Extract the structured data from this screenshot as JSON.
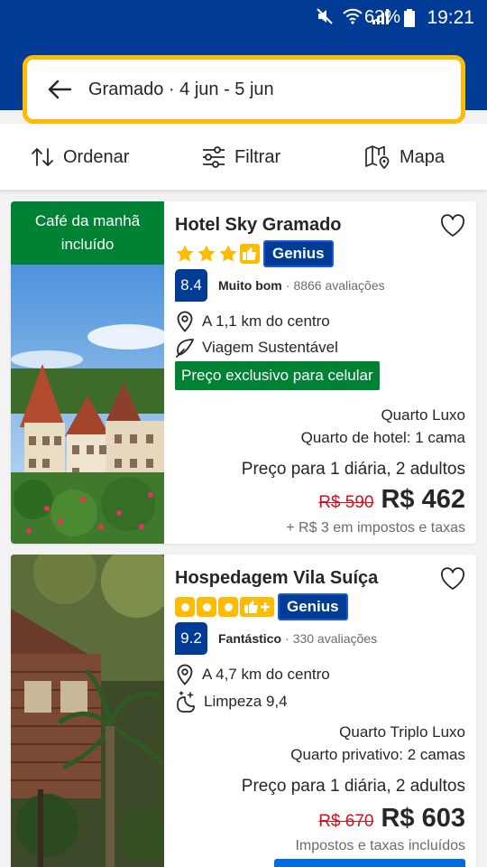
{
  "status_bar": {
    "battery_percent": "63%",
    "time": "19:21",
    "icons": [
      "mute-icon",
      "wifi-icon",
      "signal-icon",
      "battery-icon"
    ]
  },
  "search": {
    "query": "Gramado · 4 jun - 5 jun"
  },
  "toolbar": {
    "sort_label": "Ordenar",
    "filter_label": "Filtrar",
    "map_label": "Mapa"
  },
  "colors": {
    "brand_blue": "#003b95",
    "accent_yellow": "#febb02",
    "green": "#008234",
    "strike_red": "#d4111e"
  },
  "hotels": [
    {
      "breakfast_badge": "Café da manhã incluído",
      "name": "Hotel Sky Gramado",
      "star_count": 3,
      "genius_label": "Genius",
      "score": "8.4",
      "score_label": "Muito bom",
      "reviews": "8866 avaliações",
      "distance": "A 1,1 km do centro",
      "sustainable": "Viagem Sustentável",
      "mobile_deal": "Preço exclusivo para celular",
      "room_type": "Quarto Luxo",
      "room_detail": "Quarto de hotel: 1 cama",
      "price_desc": "Preço para 1 diária, 2 adultos",
      "old_price": "R$ 590",
      "price": "R$ 462",
      "taxes": "+ R$ 3 em impostos e taxas"
    },
    {
      "name": "Hospedagem Vila Suíça",
      "rating_count": 3,
      "genius_label": "Genius",
      "score": "9.2",
      "score_label": "Fantástico",
      "reviews": "330 avaliações",
      "distance": "A 4,7 km do centro",
      "cleanliness": "Limpeza 9,4",
      "room_type": "Quarto Triplo Luxo",
      "room_detail": "Quarto privativo: 2 camas",
      "price_desc": "Preço para 1 diária, 2 adultos",
      "old_price": "R$ 670",
      "price": "R$ 603",
      "taxes": "Impostos e taxas incluídos"
    }
  ]
}
